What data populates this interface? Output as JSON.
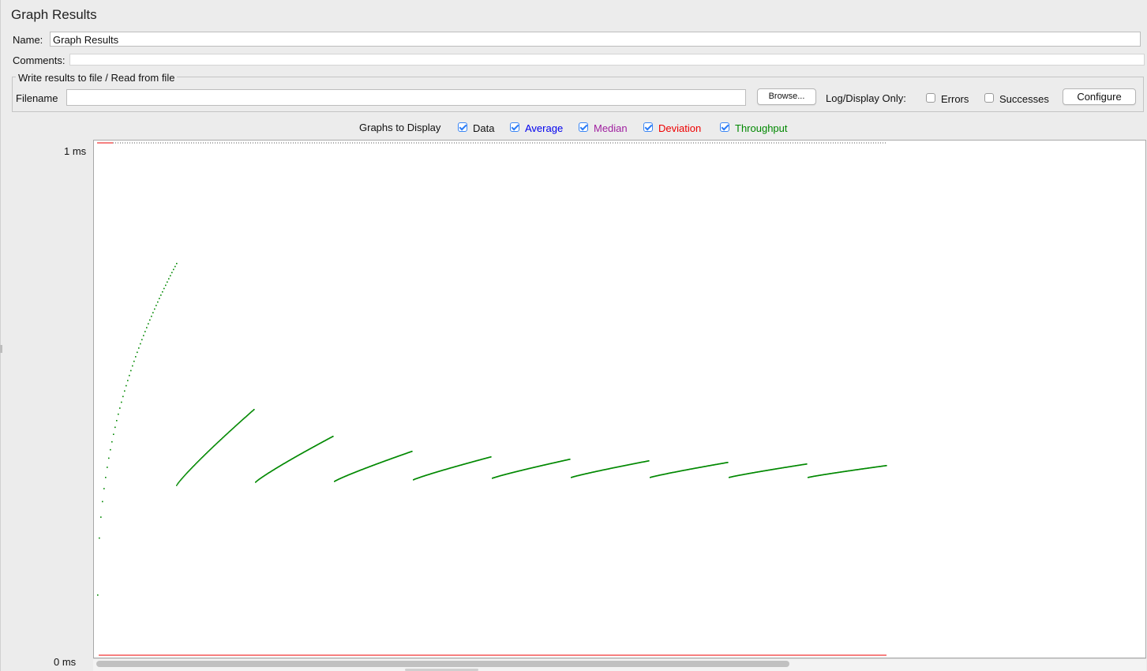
{
  "panel": {
    "title": "Graph Results"
  },
  "name_field": {
    "label": "Name:",
    "value": "Graph Results"
  },
  "comments_field": {
    "label": "Comments:",
    "value": ""
  },
  "file_section": {
    "legend": "Write results to file / Read from file",
    "filename_label": "Filename",
    "filename_value": "",
    "browse_label": "Browse...",
    "log_display_label": "Log/Display Only:",
    "errors_label": "Errors",
    "errors_checked": false,
    "successes_label": "Successes",
    "successes_checked": false,
    "configure_label": "Configure"
  },
  "graphs_to_display": {
    "label": "Graphs to Display",
    "options": [
      {
        "label": "Data",
        "checked": true,
        "color": "#111111"
      },
      {
        "label": "Average",
        "checked": true,
        "color": "#0000ee"
      },
      {
        "label": "Median",
        "checked": true,
        "color": "#a020a0"
      },
      {
        "label": "Deviation",
        "checked": true,
        "color": "#ee0000"
      },
      {
        "label": "Throughput",
        "checked": true,
        "color": "#008800"
      }
    ]
  },
  "graph": {
    "y_top_label": "1 ms",
    "y_bottom_label": "0 ms"
  },
  "colors": {
    "throughput": "#008800",
    "deviation": "#ee0000",
    "data": "#000000"
  }
}
